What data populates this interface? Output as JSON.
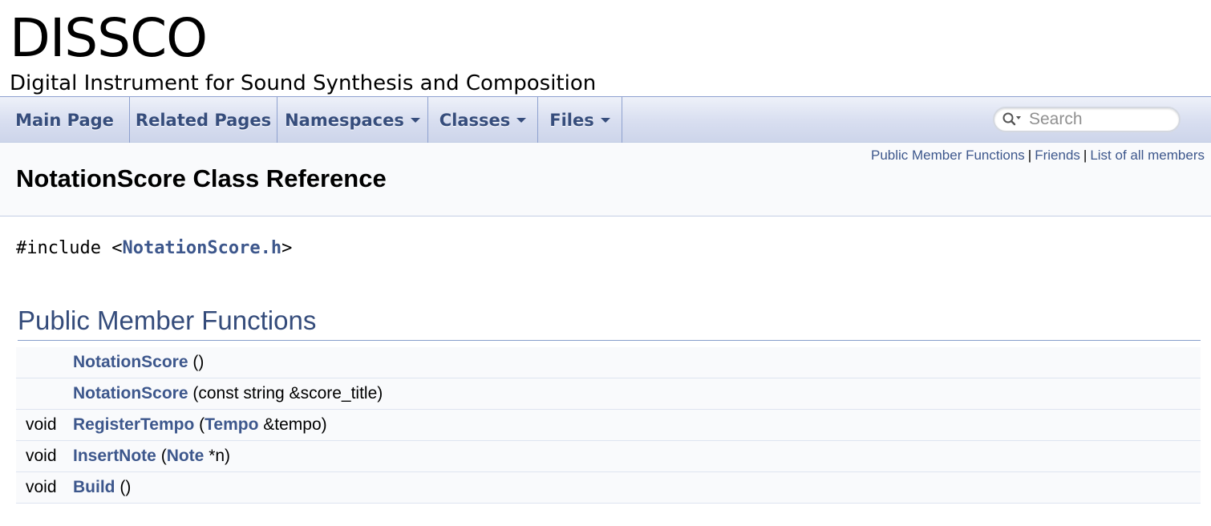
{
  "project": {
    "name": "DISSCO",
    "brief": "Digital Instrument for Sound Synthesis and Composition"
  },
  "navbar": {
    "items": [
      {
        "label": "Main Page",
        "dropdown": false
      },
      {
        "label": "Related Pages",
        "dropdown": false
      },
      {
        "label": "Namespaces",
        "dropdown": true
      },
      {
        "label": "Classes",
        "dropdown": true
      },
      {
        "label": "Files",
        "dropdown": true
      }
    ],
    "search": {
      "placeholder": "Search",
      "value": ""
    }
  },
  "header": {
    "summary_links": [
      "Public Member Functions",
      "Friends",
      "List of all members"
    ],
    "separator": "|",
    "title": "NotationScore Class Reference"
  },
  "include": {
    "prefix": "#include <",
    "file": "NotationScore.h",
    "suffix": ">"
  },
  "section": {
    "heading": "Public Member Functions",
    "members": [
      {
        "type": "",
        "name": "NotationScore",
        "args_pre": " ()",
        "param_link": "",
        "args_post": ""
      },
      {
        "type": "",
        "name": "NotationScore",
        "args_pre": " (const string &score_title)",
        "param_link": "",
        "args_post": ""
      },
      {
        "type": "void",
        "name": "RegisterTempo",
        "args_pre": " (",
        "param_link": "Tempo",
        "args_post": " &tempo)"
      },
      {
        "type": "void",
        "name": "InsertNote",
        "args_pre": " (",
        "param_link": "Note",
        "args_post": " *n)"
      },
      {
        "type": "void",
        "name": "Build",
        "args_pre": " ()",
        "param_link": "",
        "args_post": ""
      }
    ]
  },
  "colors": {
    "link": "#3d578c",
    "nav_text": "#364d7c",
    "section_heading": "#354c7b",
    "header_bg": "#f9fafc"
  }
}
